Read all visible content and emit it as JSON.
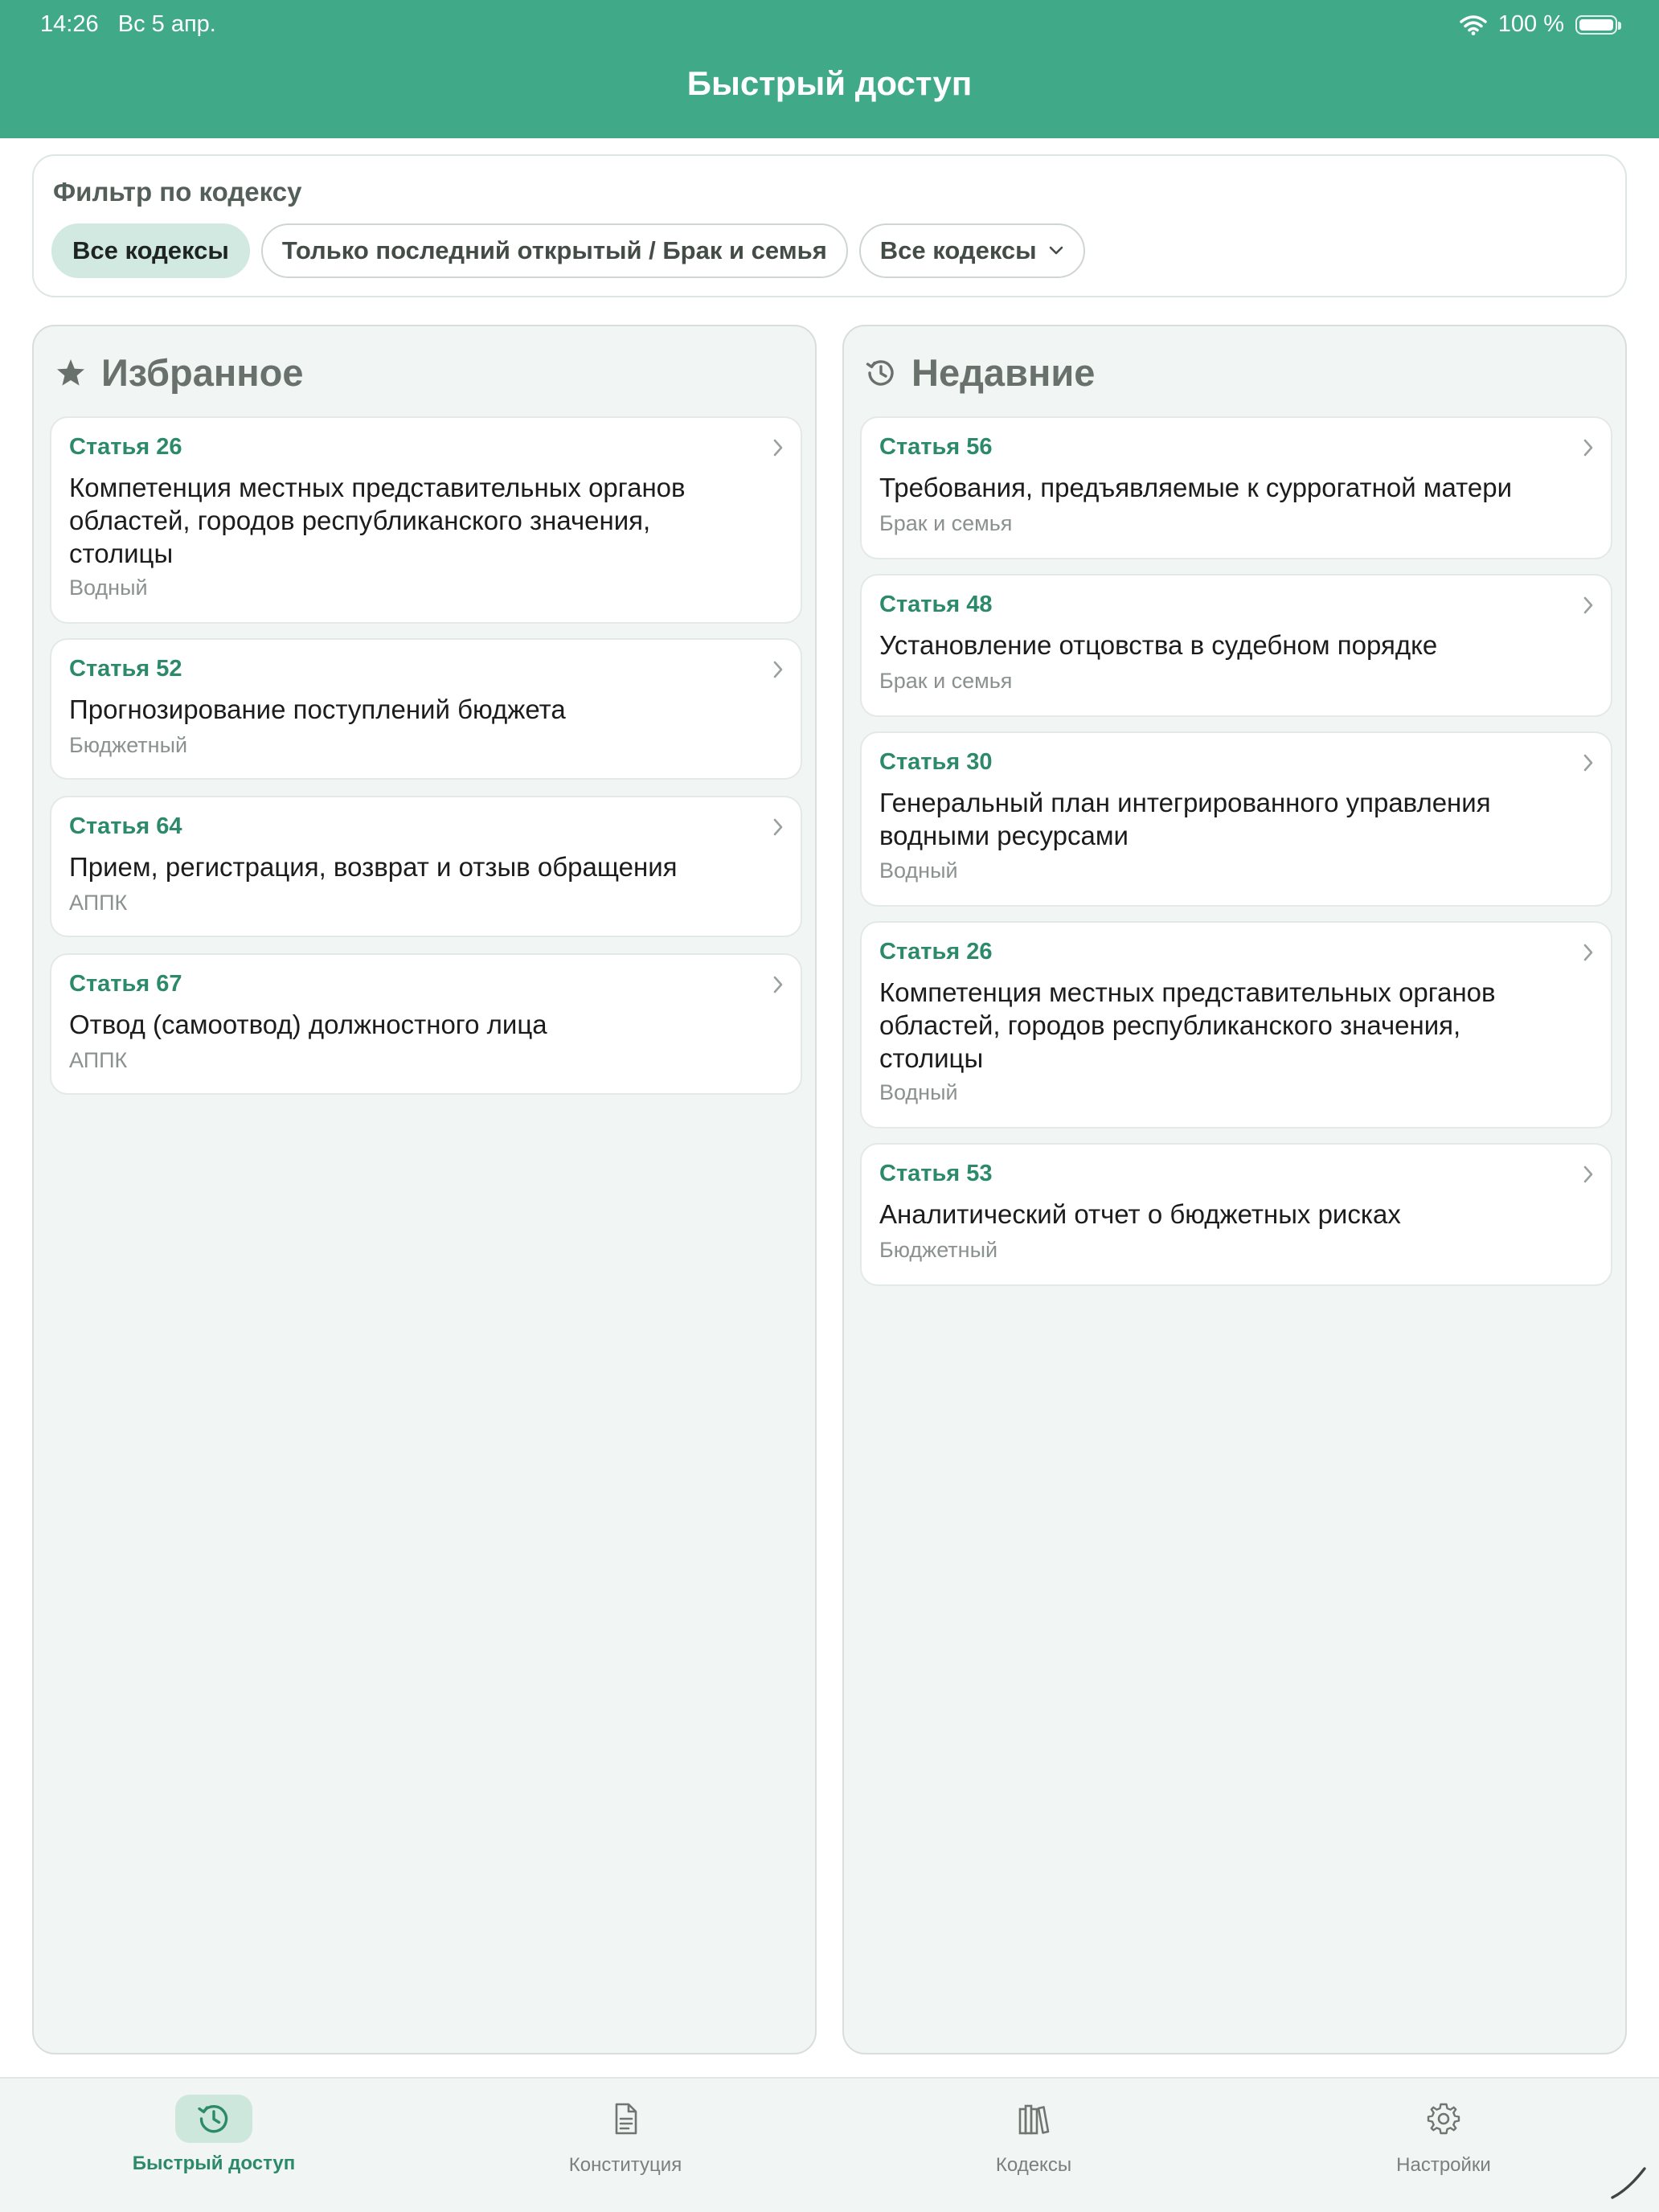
{
  "status_bar": {
    "time": "14:26",
    "date": "Вс 5 апр.",
    "battery": "100 %"
  },
  "header": {
    "title": "Быстрый доступ"
  },
  "filter": {
    "title": "Фильтр по кодексу",
    "chips": [
      {
        "label": "Все кодексы",
        "active": true
      },
      {
        "label": "Только последний открытый / Брак и семья",
        "active": false
      },
      {
        "label": "Все кодексы",
        "active": false,
        "icon": "chevron-down-icon"
      }
    ]
  },
  "favorites": {
    "title": "Избранное",
    "icon": "star-icon",
    "items": [
      {
        "number": "Статья 26",
        "title": "Компетенция местных представительных органов областей, городов республиканского значения, столицы",
        "code": "Водный"
      },
      {
        "number": "Статья 52",
        "title": "Прогнозирование поступлений бюджета",
        "code": "Бюджетный"
      },
      {
        "number": "Статья 64",
        "title": "Прием, регистрация, возврат и отзыв обращения",
        "code": "АППК"
      },
      {
        "number": "Статья 67",
        "title": "Отвод (самоотвод) должностного лица",
        "code": "АППК"
      }
    ]
  },
  "recent": {
    "title": "Недавние",
    "icon": "history-icon",
    "items": [
      {
        "number": "Статья 56",
        "title": "Требования, предъявляемые к суррогатной матери",
        "code": "Брак и семья"
      },
      {
        "number": "Статья 48",
        "title": "Установление отцовства в судебном порядке",
        "code": "Брак и семья"
      },
      {
        "number": "Статья 30",
        "title": "Генеральный план интегрированного управления водными ресурсами",
        "code": "Водный"
      },
      {
        "number": "Статья 26",
        "title": "Компетенция местных представительных органов областей, городов республиканского значения, столицы",
        "code": "Водный"
      },
      {
        "number": "Статья 53",
        "title": "Аналитический отчет о бюджетных рисках",
        "code": "Бюджетный"
      }
    ]
  },
  "tabbar": {
    "tabs": [
      {
        "label": "Быстрый доступ",
        "icon": "history-icon",
        "active": true
      },
      {
        "label": "Конституция",
        "icon": "document-icon",
        "active": false
      },
      {
        "label": "Кодексы",
        "icon": "books-icon",
        "active": false
      },
      {
        "label": "Настройки",
        "icon": "gear-icon",
        "active": false
      }
    ]
  },
  "colors": {
    "accent": "#40a988",
    "accent_text": "#2c8a6b",
    "chip_active": "#d1e9e1",
    "panel_bg": "#f1f5f3"
  }
}
